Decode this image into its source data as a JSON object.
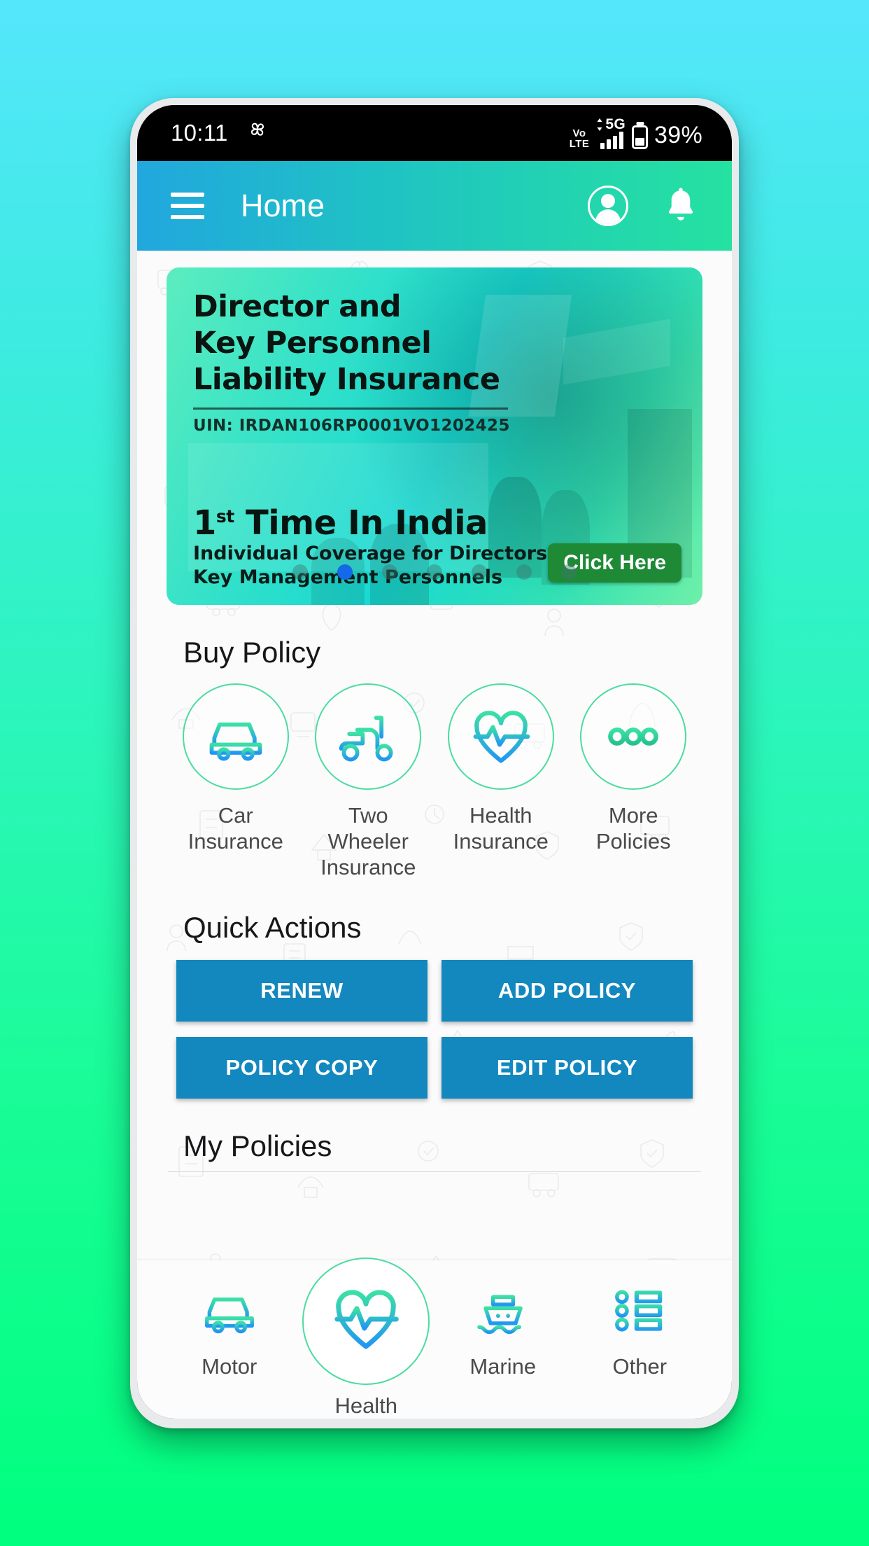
{
  "status_bar": {
    "time": "10:11",
    "left_icon": "photos-pinwheel-icon",
    "volte": "Vo\nLTE",
    "volte_line1": "Vo",
    "volte_line2": "LTE",
    "network": "5G",
    "signal_bars": 4,
    "battery_percent": "39%"
  },
  "app_bar": {
    "title": "Home",
    "menu_icon": "hamburger-menu-icon",
    "profile_icon": "account-profile-icon",
    "notification_icon": "bell-notification-icon"
  },
  "banner": {
    "heading_line1": "Director and",
    "heading_line2": "Key Personnel",
    "heading_line3": "Liability Insurance",
    "uin": "UIN: IRDAN106RP0001VO1202425",
    "tagline_number": "1",
    "tagline_sup": "st",
    "tagline_rest": " Time In India",
    "sub_line1": "Individual Coverage for Directors and",
    "sub_line2": "Key Management Personnels",
    "cta_label": "Click Here",
    "cta_color": "#1E8A36",
    "dots_total": 7,
    "dots_active_index": 1,
    "dot_active_color": "#1469E8"
  },
  "buy_policy": {
    "title": "Buy Policy",
    "items": [
      {
        "label": "Car\nInsurance",
        "line1": "Car",
        "line2": "Insurance",
        "line3": "",
        "icon": "car-icon"
      },
      {
        "label": "Two Wheeler Insurance",
        "line1": "Two",
        "line2": "Wheeler",
        "line3": "Insurance",
        "icon": "scooter-icon"
      },
      {
        "label": "Health Insurance",
        "line1": "Health",
        "line2": "Insurance",
        "line3": "",
        "icon": "heart-pulse-icon"
      },
      {
        "label": "More Policies",
        "line1": "More",
        "line2": "Policies",
        "line3": "",
        "icon": "ellipsis-icon"
      }
    ]
  },
  "quick_actions": {
    "title": "Quick Actions",
    "button_color": "#1388BF",
    "buttons": [
      {
        "label": "RENEW"
      },
      {
        "label": "ADD POLICY"
      },
      {
        "label": "POLICY COPY"
      },
      {
        "label": "EDIT POLICY"
      }
    ]
  },
  "my_policies": {
    "title": "My Policies"
  },
  "bottom_nav": {
    "selected_index": 1,
    "accent_color": "#4BDCA0",
    "items": [
      {
        "label": "Motor",
        "icon": "car-icon"
      },
      {
        "label": "Health",
        "icon": "heart-pulse-icon"
      },
      {
        "label": "Marine",
        "icon": "ship-icon"
      },
      {
        "label": "Other",
        "icon": "list-icon"
      }
    ]
  },
  "theme": {
    "background_top": "#55E6FC",
    "background_bottom": "#00FF7E",
    "appbar_from": "#21A7DE",
    "appbar_to": "#25E2A0",
    "icon_gradient_from": "#3BE0A5",
    "icon_gradient_to": "#2196F3"
  }
}
